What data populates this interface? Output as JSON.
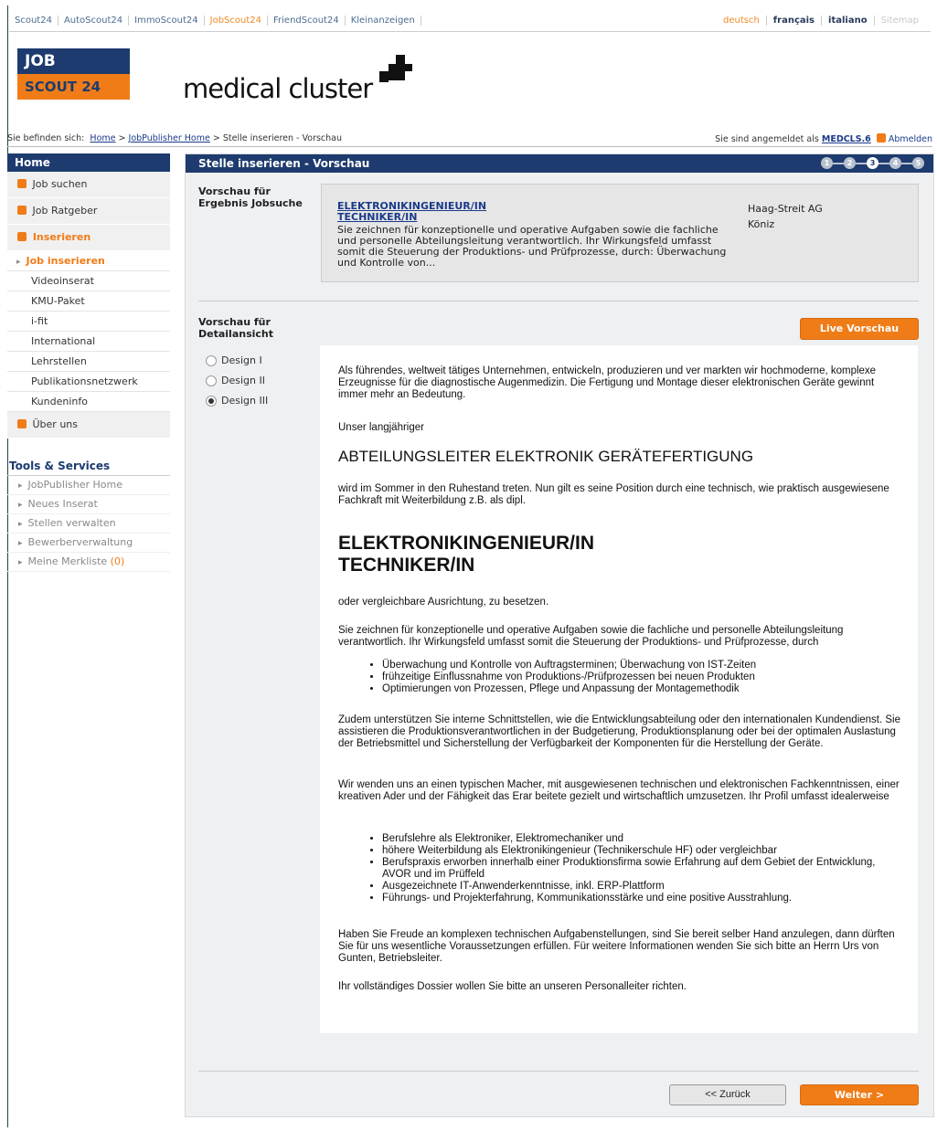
{
  "topnav": {
    "links": [
      "Scout24",
      "AutoScout24",
      "ImmoScout24",
      "JobScout24",
      "FriendScout24",
      "Kleinanzeigen"
    ],
    "active_link": "JobScout24",
    "languages": [
      "deutsch",
      "français",
      "italiano",
      "Sitemap"
    ]
  },
  "logos": {
    "jobscout_line1": "JOB",
    "jobscout_line2": "SCOUT 24",
    "medical_cluster": "medical cluster"
  },
  "breadcrumb": {
    "prefix": "Sie befinden sich:",
    "home": "Home",
    "sep": ">",
    "jobpublisher": "JobPublisher Home",
    "current": "Stelle inserieren - Vorschau"
  },
  "login": {
    "text": "Sie sind angemeldet als",
    "user": "MEDCLS.6",
    "logout": "Abmelden"
  },
  "sidebar": {
    "header": "Home",
    "items": [
      "Job suchen",
      "Job Ratgeber",
      "Inserieren"
    ],
    "sub_items": [
      "Job inserieren",
      "Videoinserat",
      "KMU-Paket",
      "i-fit",
      "International",
      "Lehrstellen",
      "Publikationsnetzwerk",
      "Kundeninfo"
    ],
    "last_item": "Über uns",
    "tools_title": "Tools & Services",
    "tools": [
      "JobPublisher Home",
      "Neues Inserat",
      "Stellen verwalten",
      "Bewerberverwaltung",
      "Meine Merkliste"
    ],
    "merkliste_count": "(0)"
  },
  "main": {
    "title": "Stelle inserieren - Vorschau",
    "steps": [
      "1",
      "2",
      "3",
      "4",
      "5"
    ],
    "current_step": 3,
    "preview_result_label1": "Vorschau für",
    "preview_result_label2": "Ergebnis Jobsuche",
    "result": {
      "title1": "ELEKTRONIKINGENIEUR/IN",
      "title2": "TECHNIKER/IN",
      "desc": "Sie zeichnen für konzeptionelle und operative Aufgaben sowie die fachliche und personelle Abteilungsleitung verantwortlich. Ihr Wirkungsfeld umfasst somit die Steuerung der Produktions- und Prüfprozesse, durch: Überwachung und Kontrolle von...",
      "company": "Haag-Streit AG",
      "location": "Köniz"
    },
    "preview_detail_label1": "Vorschau für",
    "preview_detail_label2": "Detailansicht",
    "live_button": "Live Vorschau",
    "designs": [
      "Design I",
      "Design II",
      "Design III"
    ],
    "selected_design": "Design III",
    "detail": {
      "p1": "Als führendes, weltweit tätiges Unternehmen, entwickeln, produzieren und ver markten wir hochmoderne, komplexe Erzeugnisse für die diagnostische Augenmedizin. Die Fertigung und Montage dieser elektronischen Geräte gewinnt immer mehr an Bedeutung.",
      "p2": "Unser langjähriger",
      "h_sub": "ABTEILUNGSLEITER ELEKTRONIK GERÄTEFERTIGUNG",
      "p3": "wird im Sommer in den Ruhestand treten. Nun gilt es seine Position durch eine technisch, wie praktisch ausgewiesene Fachkraft mit Weiterbildung z.B. als dipl.",
      "h_main1": "ELEKTRONIKINGENIEUR/IN",
      "h_main2": "TECHNIKER/IN",
      "p4": "oder vergleichbare Ausrichtung, zu besetzen.",
      "p5": "Sie zeichnen für konzeptionelle und operative Aufgaben sowie die fachliche und personelle Abteilungsleitung verantwortlich. Ihr Wirkungsfeld umfasst somit die Steuerung der Produktions- und Prüfprozesse, durch",
      "list1": [
        "Überwachung und Kontrolle von Auftragsterminen; Überwachung von IST-Zeiten",
        "frühzeitige Einflussnahme von Produktions-/Prüfprozessen bei neuen Produkten",
        "Optimierungen von Prozessen, Pflege und Anpassung der Montagemethodik"
      ],
      "p6": "Zudem unterstützen Sie interne Schnittstellen, wie die Entwicklungsabteilung oder den internationalen Kundendienst. Sie assistieren die Produktionsverantwortlichen in der Budgetierung, Produktionsplanung oder bei der optimalen Auslastung der Betriebsmittel und Sicherstellung der Verfügbarkeit der Komponenten für die Herstellung der Geräte.",
      "p7": "Wir wenden uns an einen typischen Macher, mit ausgewiesenen technischen und elektronischen Fachkenntnissen, einer kreativen Ader und der Fähigkeit das Erar beitete gezielt und wirtschaftlich umzusetzen. Ihr Profil umfasst idealerweise",
      "list2": [
        "Berufslehre als Elektroniker, Elektromechaniker und",
        "höhere Weiterbildung als Elektronikingenieur (Technikerschule HF) oder vergleichbar",
        "Berufspraxis erworben innerhalb einer Produktionsfirma sowie Erfahrung auf dem Gebiet der Entwicklung, AVOR und im Prüffeld",
        "Ausgezeichnete IT-Anwenderkenntnisse, inkl. ERP-Plattform",
        "Führungs- und Projekterfahrung, Kommunikationsstärke und eine positive Ausstrahlung."
      ],
      "p8": "Haben Sie Freude an komplexen technischen Aufgabenstellungen, sind Sie bereit selber Hand anzulegen, dann dürften Sie für uns wesentliche Voraussetzungen erfüllen. Für weitere Informationen wenden Sie sich bitte an Herrn Urs von Gunten, Betriebsleiter.",
      "p9": "Ihr vollständiges Dossier wollen Sie bitte an unseren Personalleiter richten."
    },
    "back_button": "<< Zurück",
    "next_button": "Weiter >"
  },
  "colors": {
    "navy": "#1d3b6e",
    "orange": "#f07c18",
    "link": "#1a3a8a"
  }
}
